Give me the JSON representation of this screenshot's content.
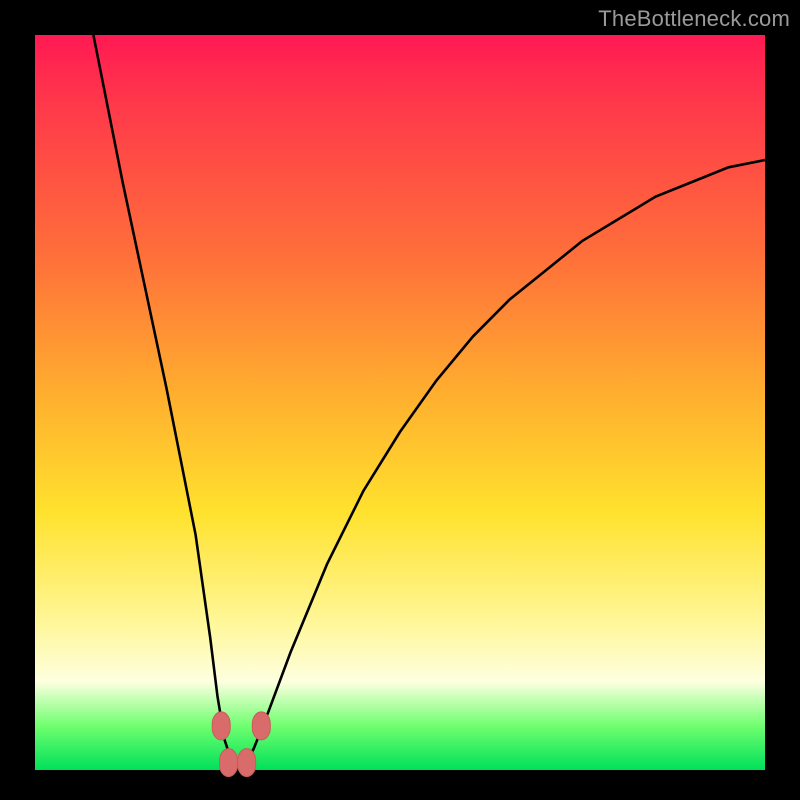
{
  "watermark": {
    "text": "TheBottleneck.com"
  },
  "colors": {
    "frame": "#000000",
    "watermark_text": "#9a9a9a",
    "curve_stroke": "#000000",
    "marker_fill": "#d96b6b",
    "marker_stroke": "#c95c5c",
    "gradient_stops": [
      "#ff1a53",
      "#ff3a4a",
      "#ff6f3a",
      "#ffb22e",
      "#ffe22e",
      "#fff799",
      "#fdffe0",
      "#6fff6f",
      "#00e05a"
    ]
  },
  "chart_data": {
    "type": "line",
    "title": "",
    "xlabel": "",
    "ylabel": "",
    "x_range": [
      0,
      100
    ],
    "y_range": [
      0,
      100
    ],
    "comment": "V-shaped bottleneck curve; y ~ 0 at optimum, rises steeply to ~100 away from optimum. x is normalized configuration axis, y is bottleneck %.",
    "series": [
      {
        "name": "bottleneck-curve",
        "x": [
          8,
          10,
          12,
          15,
          18,
          20,
          22,
          24,
          25,
          26,
          27,
          28,
          29,
          30,
          32,
          35,
          40,
          45,
          50,
          55,
          60,
          65,
          70,
          75,
          80,
          85,
          90,
          95,
          100
        ],
        "y": [
          100,
          90,
          80,
          66,
          52,
          42,
          32,
          18,
          10,
          4,
          1,
          0,
          1,
          3,
          8,
          16,
          28,
          38,
          46,
          53,
          59,
          64,
          68,
          72,
          75,
          78,
          80,
          82,
          83
        ]
      }
    ],
    "markers": [
      {
        "name": "optimum-left",
        "x": 25.5,
        "y": 6
      },
      {
        "name": "optimum-min-a",
        "x": 26.5,
        "y": 1
      },
      {
        "name": "optimum-min-b",
        "x": 29.0,
        "y": 1
      },
      {
        "name": "optimum-right",
        "x": 31.0,
        "y": 6
      }
    ]
  }
}
